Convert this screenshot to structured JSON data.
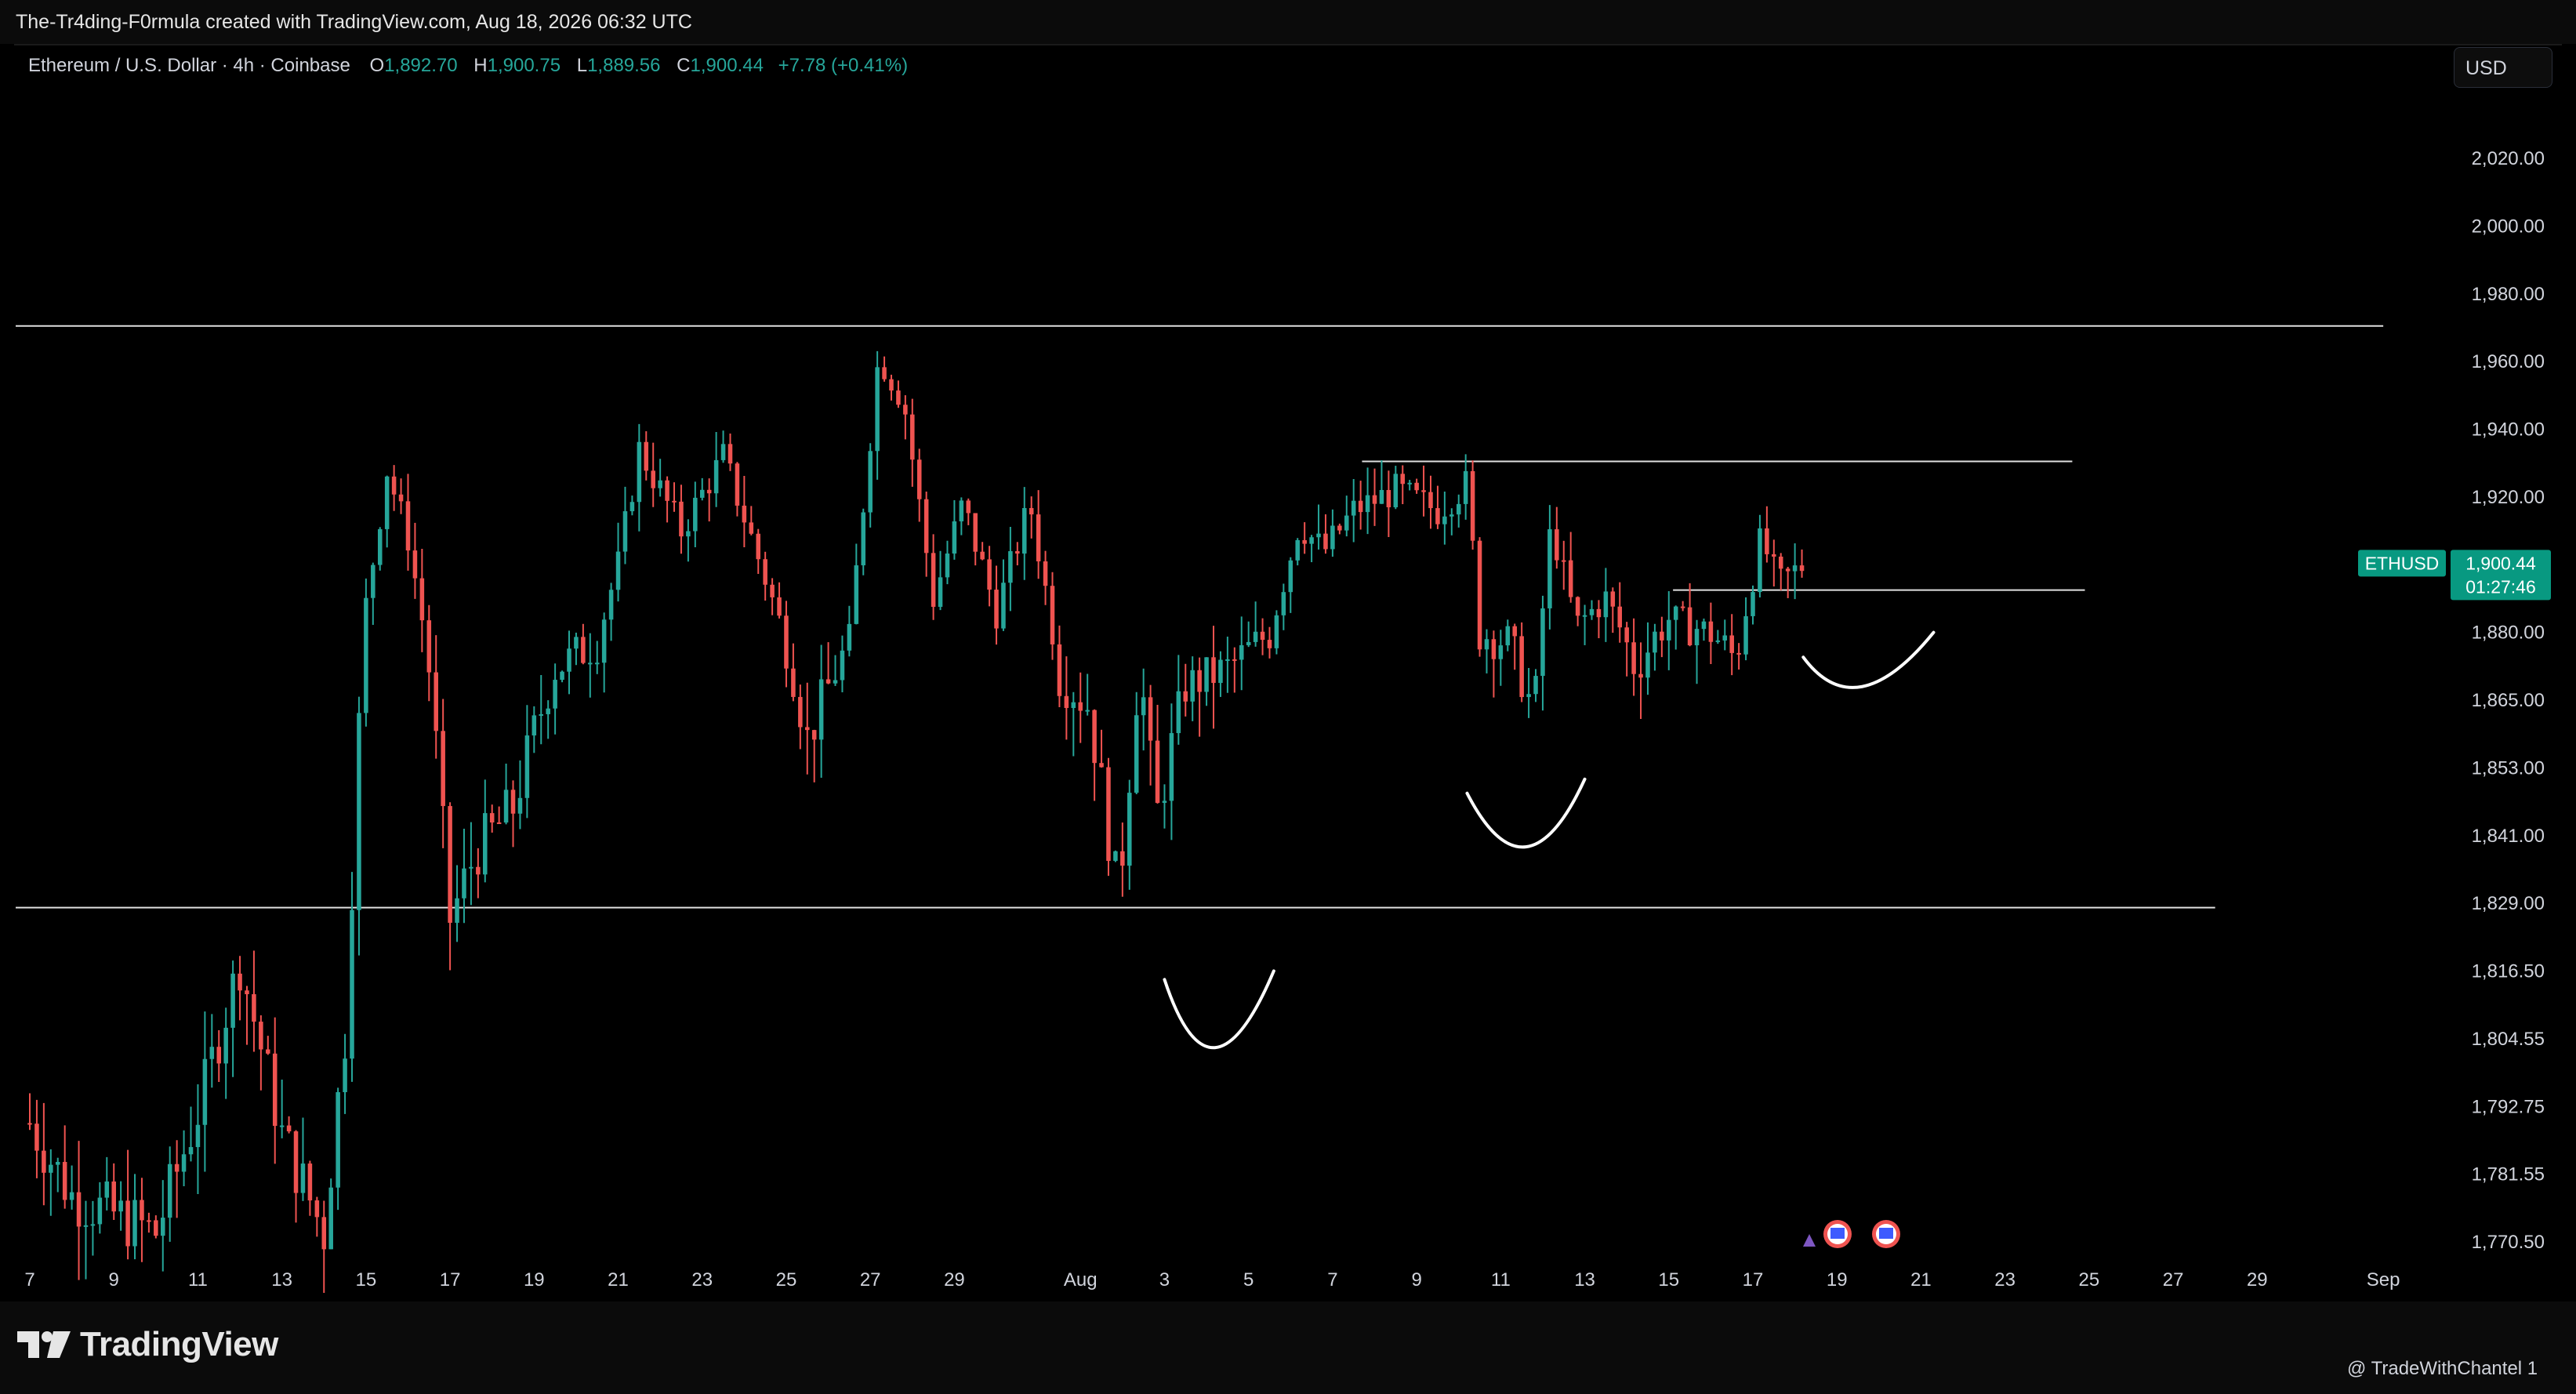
{
  "header": {
    "credit": "The-Tr4ding-F0rmula created with TradingView.com, Aug 18, 2026 06:32 UTC"
  },
  "legend": {
    "symbol": "Ethereum / U.S. Dollar · 4h · Coinbase",
    "o_label": "O",
    "o_value": "1,892.70",
    "h_label": "H",
    "h_value": "1,900.75",
    "l_label": "L",
    "l_value": "1,889.56",
    "c_label": "C",
    "c_value": "1,900.44",
    "change": "+7.78 (+0.41%)"
  },
  "currency_button": "USD",
  "price_tag": {
    "symbol": "ETHUSD",
    "price": "1,900.44",
    "countdown": "01:27:46"
  },
  "footer": {
    "brand": "TradingView",
    "handle": "@ TradeWithChantel 1"
  },
  "colors": {
    "up": "#26a69a",
    "down": "#ef5350",
    "background": "#000000",
    "lines": "#e0e0e0",
    "tag": "#089981"
  },
  "chart_data": {
    "type": "candlestick",
    "symbol": "ETHUSD",
    "timeframe": "4h",
    "exchange": "Coinbase",
    "y_ticks": [
      1770.5,
      1781.55,
      1792.75,
      1804.55,
      1816.5,
      1829.0,
      1841.0,
      1853.0,
      1865.0,
      1880.0,
      1900.0,
      1920.0,
      1940.0,
      1960.0,
      1980.0,
      2000.0,
      2020.0
    ],
    "y_tick_labels": [
      "1,770.50",
      "1,781.55",
      "1,792.75",
      "1,804.55",
      "1,816.50",
      "1,829.00",
      "1,841.00",
      "1,853.00",
      "1,865.00",
      "1,880.00",
      "1,900.00",
      "1,920.00",
      "1,940.00",
      "1,960.00",
      "1,980.00",
      "2,000.00",
      "2,020.00"
    ],
    "x_ticks": [
      "7",
      "9",
      "11",
      "13",
      "15",
      "17",
      "19",
      "21",
      "23",
      "25",
      "27",
      "29",
      "Aug",
      "3",
      "5",
      "7",
      "9",
      "11",
      "13",
      "15",
      "17",
      "19",
      "21",
      "23",
      "25",
      "27",
      "29",
      "Sep"
    ],
    "x_tick_days": [
      7,
      9,
      11,
      13,
      15,
      17,
      19,
      21,
      23,
      25,
      27,
      29,
      32,
      34,
      36,
      38,
      40,
      42,
      44,
      46,
      48,
      50,
      52,
      54,
      56,
      58,
      60,
      63
    ],
    "x_axis_start": "Jul 7",
    "key_prices": [
      {
        "day": 7,
        "price": 1790
      },
      {
        "day": 8,
        "price": 1778
      },
      {
        "day": 10,
        "price": 1772
      },
      {
        "day": 11,
        "price": 1792
      },
      {
        "day": 12,
        "price": 1818
      },
      {
        "day": 13,
        "price": 1788
      },
      {
        "day": 14,
        "price": 1772
      },
      {
        "day": 14.5,
        "price": 1805
      },
      {
        "day": 15,
        "price": 1888
      },
      {
        "day": 15.5,
        "price": 1928
      },
      {
        "day": 16,
        "price": 1908
      },
      {
        "day": 16.5,
        "price": 1872
      },
      {
        "day": 17,
        "price": 1826
      },
      {
        "day": 17.6,
        "price": 1838
      },
      {
        "day": 18.5,
        "price": 1846
      },
      {
        "day": 19.5,
        "price": 1872
      },
      {
        "day": 20.5,
        "price": 1878
      },
      {
        "day": 21,
        "price": 1900
      },
      {
        "day": 21.5,
        "price": 1934
      },
      {
        "day": 22.5,
        "price": 1910
      },
      {
        "day": 23.5,
        "price": 1932
      },
      {
        "day": 24.5,
        "price": 1896
      },
      {
        "day": 25.5,
        "price": 1858
      },
      {
        "day": 26.5,
        "price": 1878
      },
      {
        "day": 27.2,
        "price": 1962
      },
      {
        "day": 27.8,
        "price": 1948
      },
      {
        "day": 28.5,
        "price": 1890
      },
      {
        "day": 29.2,
        "price": 1918
      },
      {
        "day": 30,
        "price": 1886
      },
      {
        "day": 30.8,
        "price": 1918
      },
      {
        "day": 31.5,
        "price": 1870
      },
      {
        "day": 32.2,
        "price": 1864
      },
      {
        "day": 32.9,
        "price": 1830
      },
      {
        "day": 33.4,
        "price": 1872
      },
      {
        "day": 33.8,
        "price": 1844
      },
      {
        "day": 34.5,
        "price": 1868
      },
      {
        "day": 35.5,
        "price": 1872
      },
      {
        "day": 36.5,
        "price": 1880
      },
      {
        "day": 37.2,
        "price": 1912
      },
      {
        "day": 37.8,
        "price": 1904
      },
      {
        "day": 38.5,
        "price": 1916
      },
      {
        "day": 39.5,
        "price": 1922
      },
      {
        "day": 40.5,
        "price": 1916
      },
      {
        "day": 41.2,
        "price": 1924
      },
      {
        "day": 41.5,
        "price": 1880
      },
      {
        "day": 42.2,
        "price": 1878
      },
      {
        "day": 42.8,
        "price": 1862
      },
      {
        "day": 43.2,
        "price": 1912
      },
      {
        "day": 43.8,
        "price": 1882
      },
      {
        "day": 44.5,
        "price": 1890
      },
      {
        "day": 45.2,
        "price": 1872
      },
      {
        "day": 46,
        "price": 1884
      },
      {
        "day": 47,
        "price": 1880
      },
      {
        "day": 47.6,
        "price": 1874
      },
      {
        "day": 48.2,
        "price": 1908
      },
      {
        "day": 48.6,
        "price": 1894
      },
      {
        "day": 49.2,
        "price": 1900
      }
    ],
    "horizontal_lines": [
      {
        "price": 1970.5,
        "from_day": 5,
        "to_day": 63
      },
      {
        "price": 1828.2,
        "from_day": 5,
        "to_day": 59
      },
      {
        "price": 1930.5,
        "from_day": 38.7,
        "to_day": 55.6
      },
      {
        "price": 1892.5,
        "from_day": 46.1,
        "to_day": 55.9
      }
    ],
    "curves": [
      {
        "from": [
          34,
          1815.0
        ],
        "mid": [
          35.2,
          1803
        ],
        "to": [
          36.6,
          1816.5
        ]
      },
      {
        "from": [
          41.2,
          1848.5
        ],
        "mid": [
          42.6,
          1839
        ],
        "to": [
          44.0,
          1851
        ]
      },
      {
        "from": [
          49.2,
          1874.5
        ],
        "mid": [
          50.6,
          1868
        ],
        "to": [
          52.3,
          1880
        ]
      }
    ],
    "current_price": 1900.44,
    "grid": false,
    "legend_position": "top-left"
  }
}
